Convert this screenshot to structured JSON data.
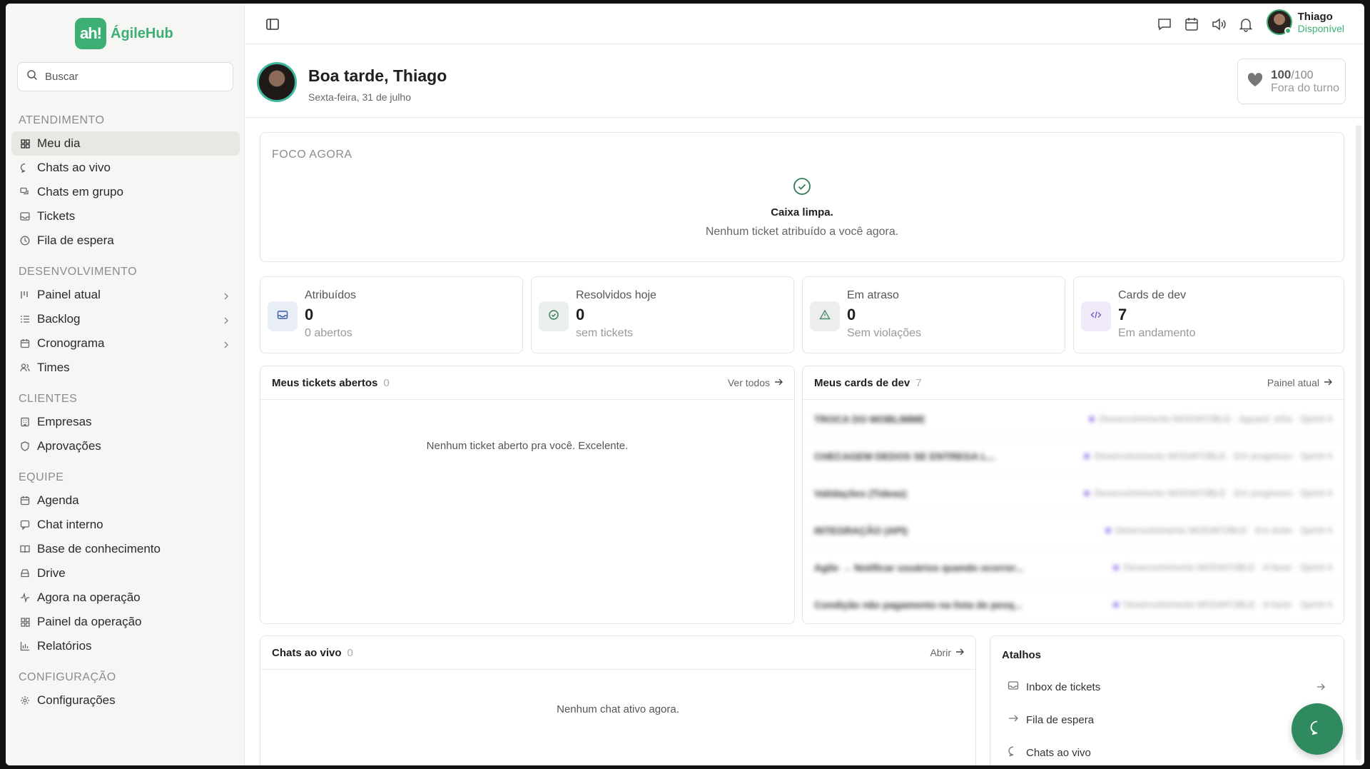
{
  "brand": {
    "mark": "ah!",
    "name": "ÁgileHub",
    "color": "#3daf75"
  },
  "search": {
    "placeholder": "Buscar"
  },
  "sidebar": {
    "sections": [
      {
        "title": "ATENDIMENTO",
        "items": [
          {
            "label": "Meu dia",
            "icon": "grid-icon",
            "active": true
          },
          {
            "label": "Chats ao vivo",
            "icon": "chat-bubble-icon"
          },
          {
            "label": "Chats em grupo",
            "icon": "chat-group-icon"
          },
          {
            "label": "Tickets",
            "icon": "inbox-icon"
          },
          {
            "label": "Fila de espera",
            "icon": "clock-icon"
          }
        ]
      },
      {
        "title": "DESENVOLVIMENTO",
        "items": [
          {
            "label": "Painel atual",
            "icon": "kanban-icon",
            "chevron": true
          },
          {
            "label": "Backlog",
            "icon": "list-icon",
            "chevron": true
          },
          {
            "label": "Cronograma",
            "icon": "calendar-icon",
            "chevron": true
          },
          {
            "label": "Times",
            "icon": "users-icon"
          }
        ]
      },
      {
        "title": "CLIENTES",
        "items": [
          {
            "label": "Empresas",
            "icon": "building-icon"
          },
          {
            "label": "Aprovações",
            "icon": "shield-icon"
          }
        ]
      },
      {
        "title": "EQUIPE",
        "items": [
          {
            "label": "Agenda",
            "icon": "calendar-icon"
          },
          {
            "label": "Chat interno",
            "icon": "chat-bubble-icon"
          },
          {
            "label": "Base de conhecimento",
            "icon": "book-icon"
          },
          {
            "label": "Drive",
            "icon": "drive-icon"
          },
          {
            "label": "Agora na operação",
            "icon": "activity-icon"
          },
          {
            "label": "Painel da operação",
            "icon": "grid-icon"
          },
          {
            "label": "Relatórios",
            "icon": "bar-chart-icon"
          }
        ]
      },
      {
        "title": "CONFIGURAÇÃO",
        "items": [
          {
            "label": "Configurações",
            "icon": "gear-icon"
          }
        ]
      }
    ]
  },
  "user": {
    "name": "Thiago",
    "status": "Disponível"
  },
  "header": {
    "greeting": "Boa tarde, Thiago",
    "date": "Sexta-feira, 31 de julho",
    "score_value": "100",
    "score_total": "/100",
    "score_label": "Fora do turno"
  },
  "focus": {
    "title": "FOCO AGORA",
    "heading": "Caixa limpa.",
    "subtitle": "Nenhum ticket atribuído a você agora."
  },
  "stats": [
    {
      "label": "Atribuídos",
      "value": "0",
      "sub": "0 abertos",
      "icon": "inbox-icon",
      "bg": "#e8edf6",
      "fg": "#3b5fa8"
    },
    {
      "label": "Resolvidos hoje",
      "value": "0",
      "sub": "sem tickets",
      "icon": "check-circle-icon",
      "bg": "#e9efea",
      "fg": "#3a7a55"
    },
    {
      "label": "Em atraso",
      "value": "0",
      "sub": "Sem violações",
      "icon": "alert-triangle-icon",
      "bg": "#eceeee",
      "fg": "#4a8a62"
    },
    {
      "label": "Cards de dev",
      "value": "7",
      "sub": "Em andamento",
      "icon": "code-icon",
      "bg": "#efe9f8",
      "fg": "#7a5bc4"
    }
  ],
  "tickets_panel": {
    "title": "Meus tickets abertos",
    "count": "0",
    "link": "Ver todos",
    "empty": "Nenhum ticket aberto pra você. Excelente."
  },
  "dev_panel": {
    "title": "Meus cards de dev",
    "count": "7",
    "link": "Painel atual",
    "rows": [
      {
        "title": "TROCA DO MOBLIMME",
        "meta": "Desenvolvimento MODAFOBLE · Aguard. infra · Sprint 4"
      },
      {
        "title": "CHECAGEM DEDOS SE ENTREGA L...",
        "meta": "Desenvolvimento MODAFOBLE · Em progresso · Sprint 4"
      },
      {
        "title": "Validações (Tideas)",
        "meta": "Desenvolvimento MODAFOBLE · Em progresso · Sprint 4"
      },
      {
        "title": "INTEGRAÇÃO (API)",
        "meta": "Desenvolvimento MODAFOBLE · Em teste · Sprint 4"
      },
      {
        "title": "Agile → Notificar usuários quando ocorrer...",
        "meta": "Desenvolvimento MODAFOBLE · A fazer · Sprint 4"
      },
      {
        "title": "Condição não pagamento na lista de pesq...",
        "meta": "Desenvolvimento MODAFOBLE · A fazer · Sprint 4"
      }
    ]
  },
  "chats_panel": {
    "title": "Chats ao vivo",
    "count": "0",
    "link": "Abrir",
    "empty": "Nenhum chat ativo agora."
  },
  "shortcuts": {
    "title": "Atalhos",
    "items": [
      {
        "label": "Inbox de tickets",
        "icon": "inbox-icon"
      },
      {
        "label": "Fila de espera",
        "icon": "arrow-right-icon"
      },
      {
        "label": "Chats ao vivo",
        "icon": "chat-bubble-icon"
      }
    ]
  }
}
